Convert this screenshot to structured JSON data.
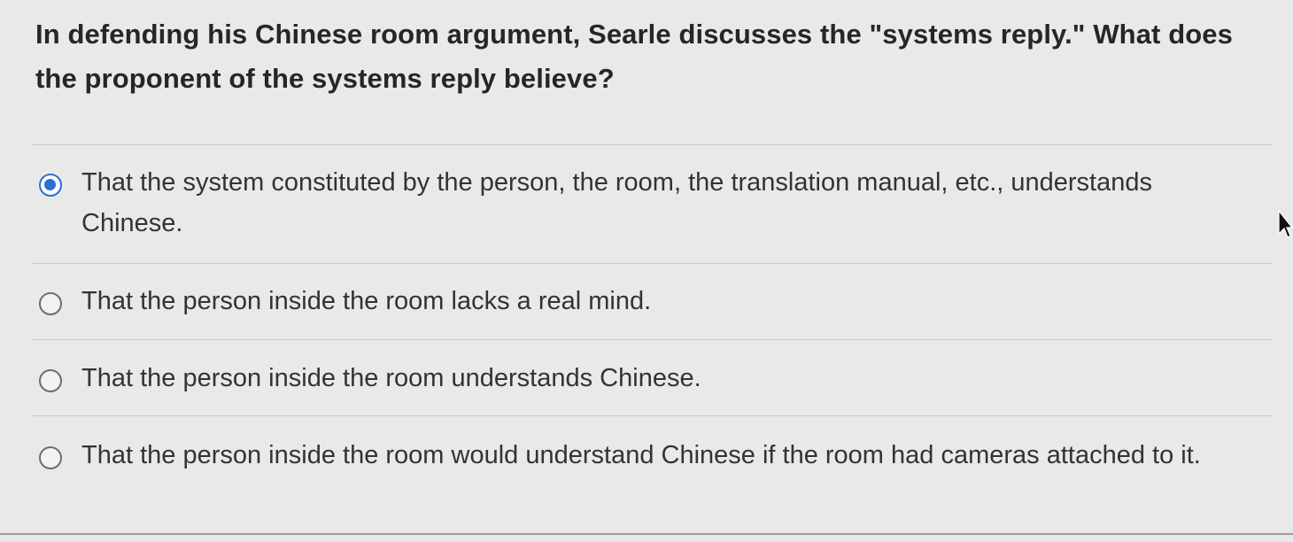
{
  "question": {
    "text": "In defending his Chinese room argument, Searle discusses the \"systems reply.\" What does the proponent of the systems reply believe?"
  },
  "options": [
    {
      "label": "That the system constituted by the person, the room, the translation manual, etc., understands Chinese.",
      "selected": true
    },
    {
      "label": "That the person inside the room lacks a real mind.",
      "selected": false
    },
    {
      "label": "That the person inside the room understands Chinese.",
      "selected": false
    },
    {
      "label": "That the person inside the room would understand Chinese if the room had cameras attached to it.",
      "selected": false
    }
  ],
  "colors": {
    "accent": "#2a6fd6",
    "background": "#e9e9e9",
    "divider": "#c9c9c9"
  }
}
